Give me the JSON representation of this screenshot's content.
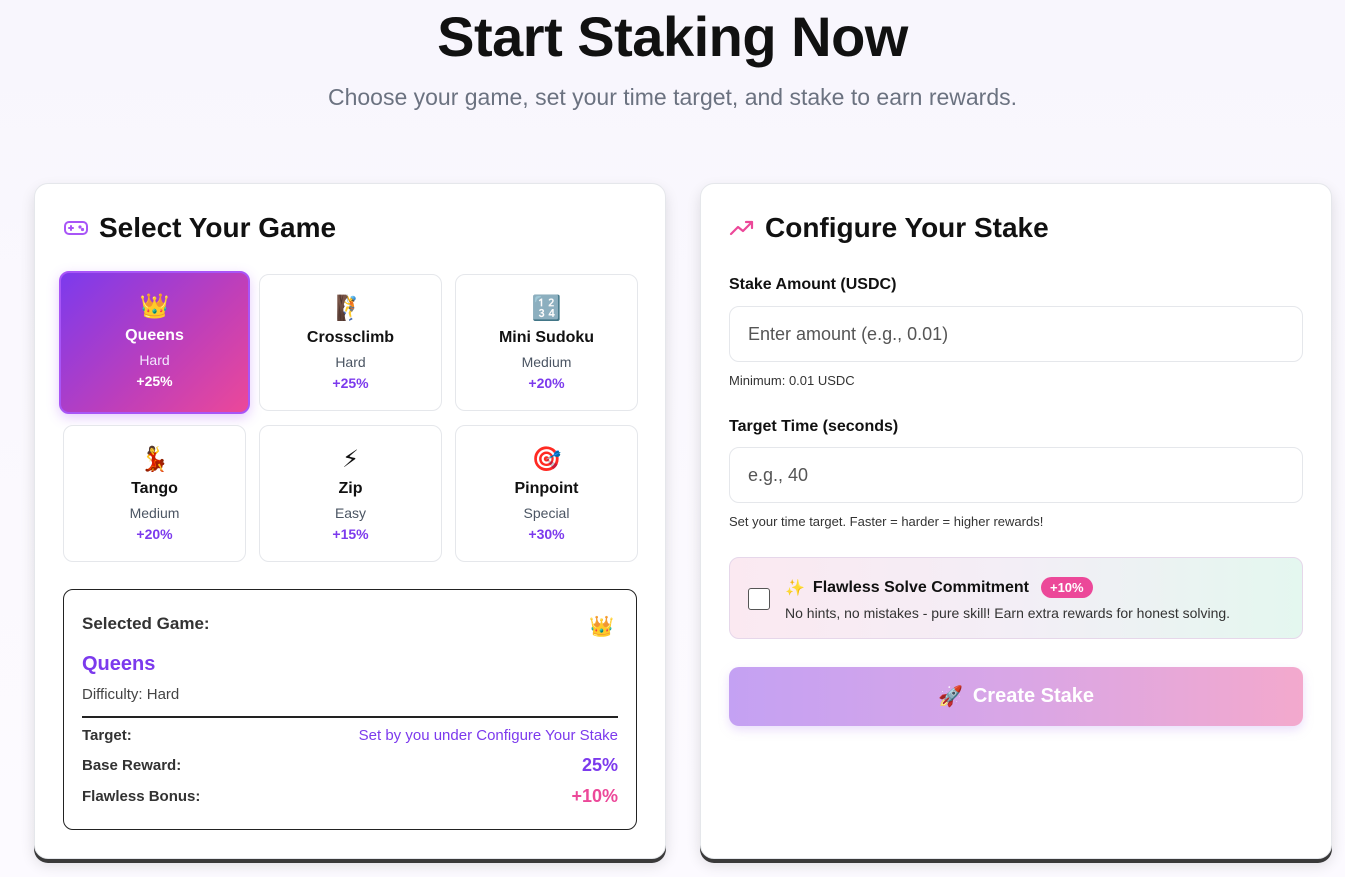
{
  "hero": {
    "title": "Start Staking Now",
    "subtitle": "Choose your game, set your time target, and stake to earn rewards."
  },
  "games_panel": {
    "title": "Select Your Game",
    "icon": "gamepad-icon",
    "games": [
      {
        "name": "Queens",
        "difficulty": "Hard",
        "bonus": "+25%",
        "icon": "👑",
        "selected": true
      },
      {
        "name": "Crossclimb",
        "difficulty": "Hard",
        "bonus": "+25%",
        "icon": "🧗"
      },
      {
        "name": "Mini Sudoku",
        "difficulty": "Medium",
        "bonus": "+20%",
        "icon": "🔢"
      },
      {
        "name": "Tango",
        "difficulty": "Medium",
        "bonus": "+20%",
        "icon": "💃"
      },
      {
        "name": "Zip",
        "difficulty": "Easy",
        "bonus": "+15%",
        "icon": "⚡"
      },
      {
        "name": "Pinpoint",
        "difficulty": "Special",
        "bonus": "+30%",
        "icon": "🎯"
      }
    ]
  },
  "summary": {
    "label": "Selected Game:",
    "icon": "👑",
    "name": "Queens",
    "difficulty": "Difficulty: Hard",
    "target_label": "Target:",
    "target_value": "Set by you under Configure Your Stake",
    "base_label": "Base Reward:",
    "base_value": "25%",
    "flawless_label": "Flawless Bonus:",
    "flawless_value": "+10%"
  },
  "config_panel": {
    "title": "Configure Your Stake",
    "icon": "trending-up-icon",
    "stake_label": "Stake Amount (USDC)",
    "stake_placeholder": "Enter amount (e.g., 0.01)",
    "stake_hint": "Minimum: 0.01 USDC",
    "time_label": "Target Time (seconds)",
    "time_placeholder": "e.g., 40",
    "time_hint": "Set your time target. Faster = harder = higher rewards!",
    "flawless_icon": "✨",
    "flawless_title": "Flawless Solve Commitment",
    "flawless_badge": "+10%",
    "flawless_desc": "No hints, no mistakes - pure skill! Earn extra rewards for honest solving.",
    "flawless_checked": false,
    "button_icon": "🚀",
    "button_label": "Create Stake"
  },
  "colors": {
    "accent_purple": "#7c3aed",
    "accent_pink": "#ec4899"
  }
}
